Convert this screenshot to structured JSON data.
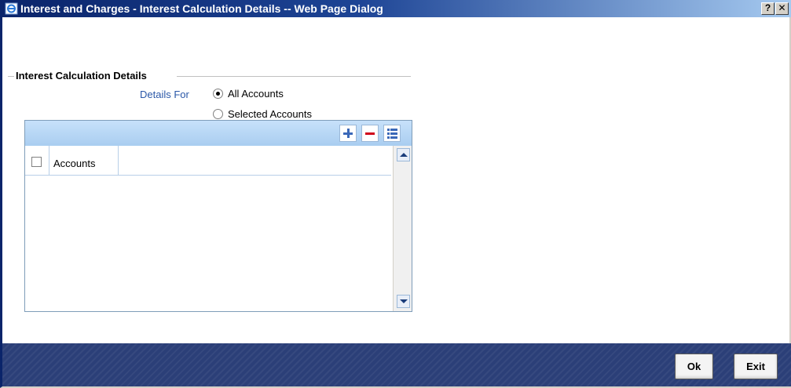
{
  "window": {
    "title": "Interest and Charges - Interest Calculation Details -- Web Page Dialog",
    "help_label": "?",
    "close_label": "✕"
  },
  "section": {
    "legend": "Interest Calculation Details"
  },
  "details_for": {
    "label": "Details For",
    "options": [
      {
        "label": "All Accounts",
        "selected": true
      },
      {
        "label": "Selected Accounts",
        "selected": false
      }
    ]
  },
  "grid": {
    "columns": [
      "Accounts"
    ],
    "rows": []
  },
  "footer": {
    "ok_label": "Ok",
    "exit_label": "Exit"
  },
  "colors": {
    "title_bar": "#0a246a",
    "footer": "#2b3f78",
    "label_blue": "#2b58a8",
    "grid_toolbar": "#c7e1fa"
  }
}
